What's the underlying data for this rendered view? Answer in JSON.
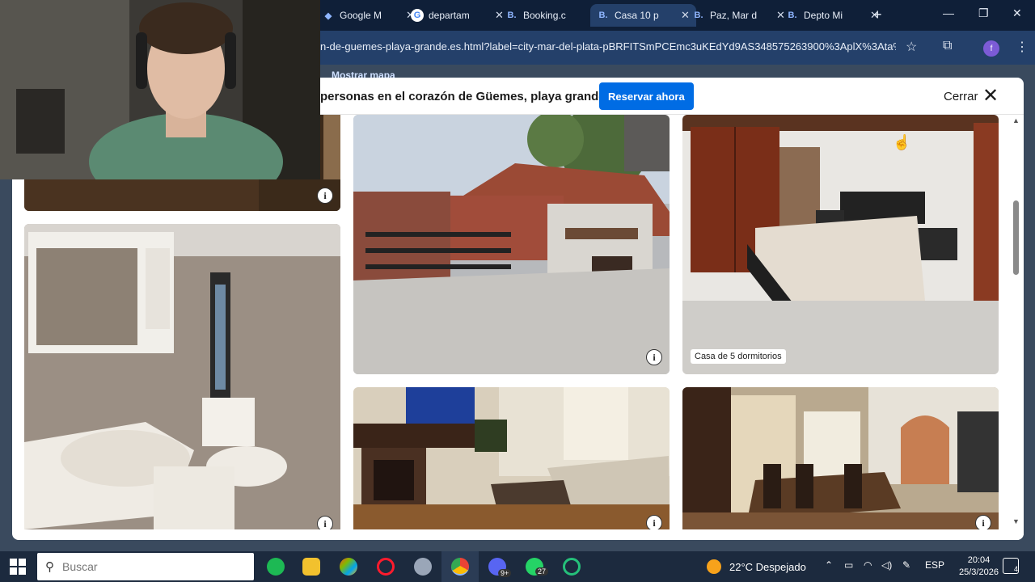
{
  "browser": {
    "tabs": [
      {
        "label": "Google M",
        "favicon": "google-icon",
        "active": false
      },
      {
        "label": "departam",
        "favicon": "google-icon",
        "active": false
      },
      {
        "label": "Booking.c",
        "favicon": "booking-icon",
        "active": false
      },
      {
        "label": "Casa 10 p",
        "favicon": "booking-icon",
        "active": true
      },
      {
        "label": "Paz, Mar d",
        "favicon": "booking-icon",
        "active": false
      },
      {
        "label": "Depto Mi",
        "favicon": "booking-icon",
        "active": false
      }
    ],
    "url": "n-de-guemes-playa-grande.es.html?label=city-mar-del-plata-pBRFITSmPCEmc3uKEdYd9AS348575263900%3AplX%3Ata%",
    "profile_initial": "f"
  },
  "background_page": {
    "link": "Mostrar mapa"
  },
  "modal": {
    "title": "personas en el corazón de Güemes, playa grande",
    "reserve_button": "Reservar ahora",
    "close_label": "Cerrar",
    "photos": [
      {
        "id": "wood-detail",
        "caption": ""
      },
      {
        "id": "terrace-grill",
        "caption": ""
      },
      {
        "id": "bedroom",
        "caption": "Casa de 5 dormitorios"
      },
      {
        "id": "bathroom",
        "caption": ""
      },
      {
        "id": "living-fireplace",
        "caption": ""
      },
      {
        "id": "dining-room",
        "caption": ""
      }
    ]
  },
  "taskbar": {
    "search_placeholder": "Buscar",
    "whatsapp_badge": "27",
    "discord_badge": "9+",
    "weather": "22°C  Despejado",
    "language": "ESP",
    "time": "20:04",
    "date": "25/3/2026",
    "notifications": "4"
  },
  "colors": {
    "booking_blue": "#006ce4",
    "chrome_dark": "#0f1f38",
    "chrome_active": "#24406a"
  }
}
